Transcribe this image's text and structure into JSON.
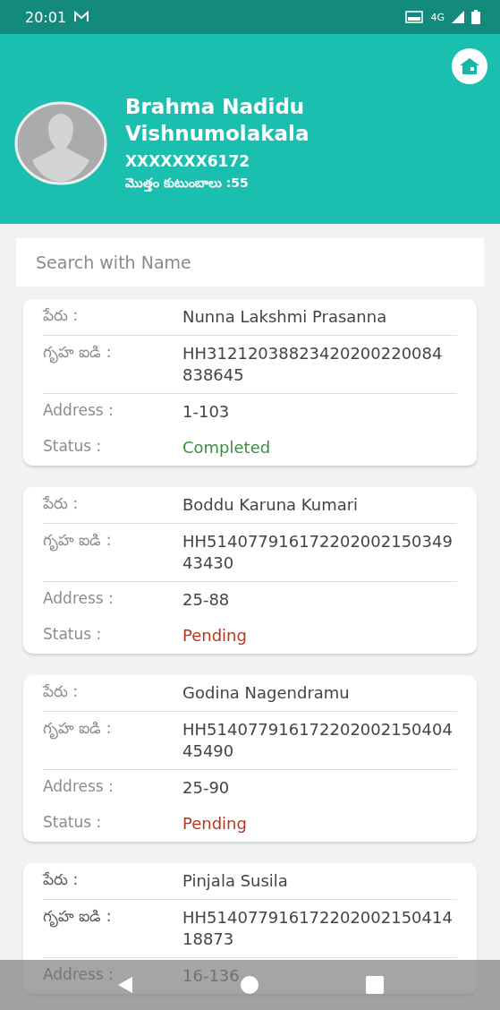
{
  "status_bar": {
    "time": "20:01",
    "network": "4G"
  },
  "profile": {
    "name_line1": "Brahma Nadidu",
    "name_line2": "Vishnumolakala",
    "id": "XXXXXXX6172",
    "total": "మొత్తం కుటుంబాలు :55"
  },
  "search": {
    "placeholder": "Search with Name"
  },
  "households": [
    {
      "name_label": "పేరు :",
      "name": "Nunna Lakshmi Prasanna",
      "id_label": "గృహ ఐడి :",
      "household_id": "HH31212038823420200220084 838645",
      "address_label": "Address :",
      "address": "1-103",
      "status_label": "Status :",
      "status": "Completed",
      "kind": "completed"
    },
    {
      "name_label": "పేరు :",
      "name": "Boddu Karuna Kumari",
      "id_label": "గృహ ఐడి :",
      "household_id": "HH514077916172202002150349 43430",
      "address_label": "Address :",
      "address": "25-88",
      "status_label": "Status :",
      "status": "Pending",
      "kind": "pending"
    },
    {
      "name_label": "పేరు :",
      "name": "Godina Nagendramu",
      "id_label": "గృహ ఐడి :",
      "household_id": "HH514077916172202002150404 45490",
      "address_label": "Address :",
      "address": "25-90",
      "status_label": "Status :",
      "status": "Pending",
      "kind": "pending"
    },
    {
      "name_label": "పేరు :",
      "name": "Pinjala Susila",
      "id_label": "గృహ ఐడి :",
      "household_id": "HH514077916172202002150414 18873",
      "address_label": "Address :",
      "address": "16-136"
    }
  ]
}
